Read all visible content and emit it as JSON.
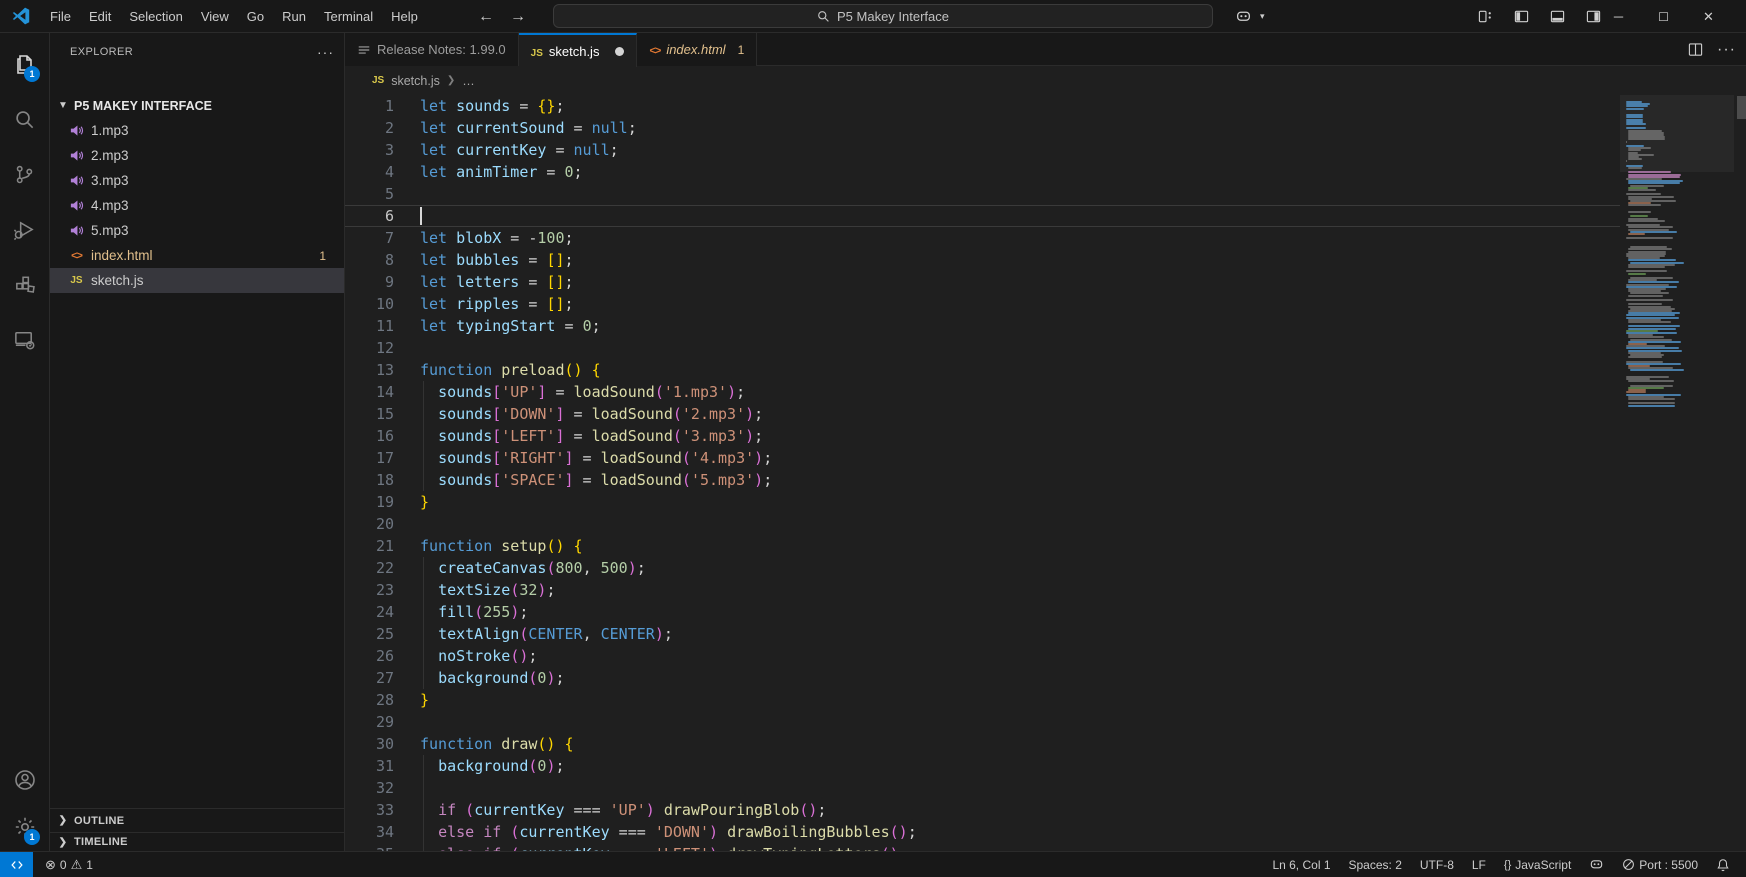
{
  "colors": {
    "accent": "#0078d4",
    "warning_file": "#e2c08d",
    "badge": "#0078d4",
    "editor_bg": "#1f1f1f",
    "chrome_bg": "#181818"
  },
  "titlebar": {
    "menu": [
      "File",
      "Edit",
      "Selection",
      "View",
      "Go",
      "Run",
      "Terminal",
      "Help"
    ],
    "command_center": "P5 Makey Interface",
    "window_buttons": [
      "minimize",
      "maximize",
      "close"
    ]
  },
  "activity_bar": {
    "top": [
      {
        "name": "explorer",
        "active": true,
        "badge": "1"
      },
      {
        "name": "search"
      },
      {
        "name": "source-control"
      },
      {
        "name": "run-debug"
      },
      {
        "name": "extensions"
      },
      {
        "name": "remote-explorer"
      }
    ],
    "bottom": [
      {
        "name": "account"
      },
      {
        "name": "settings",
        "badge": "1"
      }
    ]
  },
  "sidebar": {
    "panel_title": "EXPLORER",
    "project": "P5 MAKEY INTERFACE",
    "files": [
      {
        "name": "1.mp3",
        "icon": "audio"
      },
      {
        "name": "2.mp3",
        "icon": "audio"
      },
      {
        "name": "3.mp3",
        "icon": "audio"
      },
      {
        "name": "4.mp3",
        "icon": "audio"
      },
      {
        "name": "5.mp3",
        "icon": "audio"
      },
      {
        "name": "index.html",
        "icon": "html",
        "badge": "1",
        "tint": "#e2c08d"
      },
      {
        "name": "sketch.js",
        "icon": "js",
        "selected": true
      }
    ],
    "sections": [
      "OUTLINE",
      "TIMELINE"
    ]
  },
  "tabs": [
    {
      "label": "Release Notes: 1.99.0",
      "icon": "list"
    },
    {
      "label": "sketch.js",
      "icon": "js",
      "active": true,
      "dirty": true
    },
    {
      "label": "index.html",
      "icon": "html",
      "italic": true,
      "badge": "1",
      "tint": "#e2c08d"
    }
  ],
  "breadcrumb": {
    "file": "sketch.js",
    "more": "…"
  },
  "editor": {
    "cursor": {
      "line": 6,
      "col": 1,
      "status": "Ln 6, Col 1"
    },
    "lines": [
      [
        [
          "kw",
          "let"
        ],
        [
          "pl",
          " "
        ],
        [
          "var",
          "sounds"
        ],
        [
          "pl",
          " = "
        ],
        [
          "b1",
          "{}"
        ],
        [
          "pl",
          ";"
        ]
      ],
      [
        [
          "kw",
          "let"
        ],
        [
          "pl",
          " "
        ],
        [
          "var",
          "currentSound"
        ],
        [
          "pl",
          " = "
        ],
        [
          "kw",
          "null"
        ],
        [
          "pl",
          ";"
        ]
      ],
      [
        [
          "kw",
          "let"
        ],
        [
          "pl",
          " "
        ],
        [
          "var",
          "currentKey"
        ],
        [
          "pl",
          " = "
        ],
        [
          "kw",
          "null"
        ],
        [
          "pl",
          ";"
        ]
      ],
      [
        [
          "kw",
          "let"
        ],
        [
          "pl",
          " "
        ],
        [
          "var",
          "animTimer"
        ],
        [
          "pl",
          " = "
        ],
        [
          "num",
          "0"
        ],
        [
          "pl",
          ";"
        ]
      ],
      [],
      [],
      [
        [
          "kw",
          "let"
        ],
        [
          "pl",
          " "
        ],
        [
          "var",
          "blobX"
        ],
        [
          "pl",
          " = -"
        ],
        [
          "num",
          "100"
        ],
        [
          "pl",
          ";"
        ]
      ],
      [
        [
          "kw",
          "let"
        ],
        [
          "pl",
          " "
        ],
        [
          "var",
          "bubbles"
        ],
        [
          "pl",
          " = "
        ],
        [
          "b1",
          "[]"
        ],
        [
          "pl",
          ";"
        ]
      ],
      [
        [
          "kw",
          "let"
        ],
        [
          "pl",
          " "
        ],
        [
          "var",
          "letters"
        ],
        [
          "pl",
          " = "
        ],
        [
          "b1",
          "[]"
        ],
        [
          "pl",
          ";"
        ]
      ],
      [
        [
          "kw",
          "let"
        ],
        [
          "pl",
          " "
        ],
        [
          "var",
          "ripples"
        ],
        [
          "pl",
          " = "
        ],
        [
          "b1",
          "[]"
        ],
        [
          "pl",
          ";"
        ]
      ],
      [
        [
          "kw",
          "let"
        ],
        [
          "pl",
          " "
        ],
        [
          "var",
          "typingStart"
        ],
        [
          "pl",
          " = "
        ],
        [
          "num",
          "0"
        ],
        [
          "pl",
          ";"
        ]
      ],
      [],
      [
        [
          "kw",
          "function"
        ],
        [
          "pl",
          " "
        ],
        [
          "fn",
          "preload"
        ],
        [
          "b1",
          "()"
        ],
        [
          "pl",
          " "
        ],
        [
          "b1",
          "{"
        ]
      ],
      [
        [
          "pl",
          "  "
        ],
        [
          "var",
          "sounds"
        ],
        [
          "b2",
          "["
        ],
        [
          "str",
          "'UP'"
        ],
        [
          "b2",
          "]"
        ],
        [
          "pl",
          " = "
        ],
        [
          "fn",
          "loadSound"
        ],
        [
          "b2",
          "("
        ],
        [
          "str",
          "'1.mp3'"
        ],
        [
          "b2",
          ")"
        ],
        [
          "pl",
          ";"
        ]
      ],
      [
        [
          "pl",
          "  "
        ],
        [
          "var",
          "sounds"
        ],
        [
          "b2",
          "["
        ],
        [
          "str",
          "'DOWN'"
        ],
        [
          "b2",
          "]"
        ],
        [
          "pl",
          " = "
        ],
        [
          "fn",
          "loadSound"
        ],
        [
          "b2",
          "("
        ],
        [
          "str",
          "'2.mp3'"
        ],
        [
          "b2",
          ")"
        ],
        [
          "pl",
          ";"
        ]
      ],
      [
        [
          "pl",
          "  "
        ],
        [
          "var",
          "sounds"
        ],
        [
          "b2",
          "["
        ],
        [
          "str",
          "'LEFT'"
        ],
        [
          "b2",
          "]"
        ],
        [
          "pl",
          " = "
        ],
        [
          "fn",
          "loadSound"
        ],
        [
          "b2",
          "("
        ],
        [
          "str",
          "'3.mp3'"
        ],
        [
          "b2",
          ")"
        ],
        [
          "pl",
          ";"
        ]
      ],
      [
        [
          "pl",
          "  "
        ],
        [
          "var",
          "sounds"
        ],
        [
          "b2",
          "["
        ],
        [
          "str",
          "'RIGHT'"
        ],
        [
          "b2",
          "]"
        ],
        [
          "pl",
          " = "
        ],
        [
          "fn",
          "loadSound"
        ],
        [
          "b2",
          "("
        ],
        [
          "str",
          "'4.mp3'"
        ],
        [
          "b2",
          ")"
        ],
        [
          "pl",
          ";"
        ]
      ],
      [
        [
          "pl",
          "  "
        ],
        [
          "var",
          "sounds"
        ],
        [
          "b2",
          "["
        ],
        [
          "str",
          "'SPACE'"
        ],
        [
          "b2",
          "]"
        ],
        [
          "pl",
          " = "
        ],
        [
          "fn",
          "loadSound"
        ],
        [
          "b2",
          "("
        ],
        [
          "str",
          "'5.mp3'"
        ],
        [
          "b2",
          ")"
        ],
        [
          "pl",
          ";"
        ]
      ],
      [
        [
          "b1",
          "}"
        ]
      ],
      [],
      [
        [
          "kw",
          "function"
        ],
        [
          "pl",
          " "
        ],
        [
          "fn",
          "setup"
        ],
        [
          "b1",
          "()"
        ],
        [
          "pl",
          " "
        ],
        [
          "b1",
          "{"
        ]
      ],
      [
        [
          "pl",
          "  "
        ],
        [
          "var",
          "createCanvas"
        ],
        [
          "b2",
          "("
        ],
        [
          "num",
          "800"
        ],
        [
          "pl",
          ", "
        ],
        [
          "num",
          "500"
        ],
        [
          "b2",
          ")"
        ],
        [
          "pl",
          ";"
        ]
      ],
      [
        [
          "pl",
          "  "
        ],
        [
          "var",
          "textSize"
        ],
        [
          "b2",
          "("
        ],
        [
          "num",
          "32"
        ],
        [
          "b2",
          ")"
        ],
        [
          "pl",
          ";"
        ]
      ],
      [
        [
          "pl",
          "  "
        ],
        [
          "var",
          "fill"
        ],
        [
          "b2",
          "("
        ],
        [
          "num",
          "255"
        ],
        [
          "b2",
          ")"
        ],
        [
          "pl",
          ";"
        ]
      ],
      [
        [
          "pl",
          "  "
        ],
        [
          "var",
          "textAlign"
        ],
        [
          "b2",
          "("
        ],
        [
          "kw",
          "CENTER"
        ],
        [
          "pl",
          ", "
        ],
        [
          "kw",
          "CENTER"
        ],
        [
          "b2",
          ")"
        ],
        [
          "pl",
          ";"
        ]
      ],
      [
        [
          "pl",
          "  "
        ],
        [
          "var",
          "noStroke"
        ],
        [
          "b2",
          "()"
        ],
        [
          "pl",
          ";"
        ]
      ],
      [
        [
          "pl",
          "  "
        ],
        [
          "var",
          "background"
        ],
        [
          "b2",
          "("
        ],
        [
          "num",
          "0"
        ],
        [
          "b2",
          ")"
        ],
        [
          "pl",
          ";"
        ]
      ],
      [
        [
          "b1",
          "}"
        ]
      ],
      [],
      [
        [
          "kw",
          "function"
        ],
        [
          "pl",
          " "
        ],
        [
          "fn",
          "draw"
        ],
        [
          "b1",
          "()"
        ],
        [
          "pl",
          " "
        ],
        [
          "b1",
          "{"
        ]
      ],
      [
        [
          "pl",
          "  "
        ],
        [
          "var",
          "background"
        ],
        [
          "b2",
          "("
        ],
        [
          "num",
          "0"
        ],
        [
          "b2",
          ")"
        ],
        [
          "pl",
          ";"
        ]
      ],
      [],
      [
        [
          "pl",
          "  "
        ],
        [
          "ctrl",
          "if"
        ],
        [
          "pl",
          " "
        ],
        [
          "b2",
          "("
        ],
        [
          "var",
          "currentKey"
        ],
        [
          "pl",
          " === "
        ],
        [
          "str",
          "'UP'"
        ],
        [
          "b2",
          ")"
        ],
        [
          "pl",
          " "
        ],
        [
          "fn",
          "drawPouringBlob"
        ],
        [
          "b2",
          "()"
        ],
        [
          "pl",
          ";"
        ]
      ],
      [
        [
          "pl",
          "  "
        ],
        [
          "ctrl",
          "else"
        ],
        [
          "pl",
          " "
        ],
        [
          "ctrl",
          "if"
        ],
        [
          "pl",
          " "
        ],
        [
          "b2",
          "("
        ],
        [
          "var",
          "currentKey"
        ],
        [
          "pl",
          " === "
        ],
        [
          "str",
          "'DOWN'"
        ],
        [
          "b2",
          ")"
        ],
        [
          "pl",
          " "
        ],
        [
          "fn",
          "drawBoilingBubbles"
        ],
        [
          "b2",
          "()"
        ],
        [
          "pl",
          ";"
        ]
      ],
      [
        [
          "pl",
          "  "
        ],
        [
          "ctrl",
          "else"
        ],
        [
          "pl",
          " "
        ],
        [
          "ctrl",
          "if"
        ],
        [
          "pl",
          " "
        ],
        [
          "b2",
          "("
        ],
        [
          "var",
          "currentKey"
        ],
        [
          "pl",
          " === "
        ],
        [
          "str",
          "'LEFT'"
        ],
        [
          "b2",
          ")"
        ],
        [
          "pl",
          " "
        ],
        [
          "fn",
          "drawTypingLetters"
        ],
        [
          "b2",
          "()"
        ],
        [
          "pl",
          ";"
        ]
      ]
    ]
  },
  "status_bar": {
    "remote_tooltip": "remote-indicator",
    "problems": {
      "errors": "0",
      "warnings": "1"
    },
    "right": [
      {
        "name": "cursor-position",
        "label": "Ln 6, Col 1"
      },
      {
        "name": "indentation",
        "label": "Spaces: 2"
      },
      {
        "name": "encoding",
        "label": "UTF-8"
      },
      {
        "name": "eol",
        "label": "LF"
      },
      {
        "name": "language-mode",
        "label": "JavaScript",
        "icon": "braces"
      },
      {
        "name": "copilot-status",
        "label": "",
        "icon": "copilot"
      },
      {
        "name": "live-server-port",
        "label": "Port : 5500",
        "icon": "circle-slash"
      },
      {
        "name": "notifications",
        "label": "",
        "icon": "bell"
      }
    ]
  }
}
